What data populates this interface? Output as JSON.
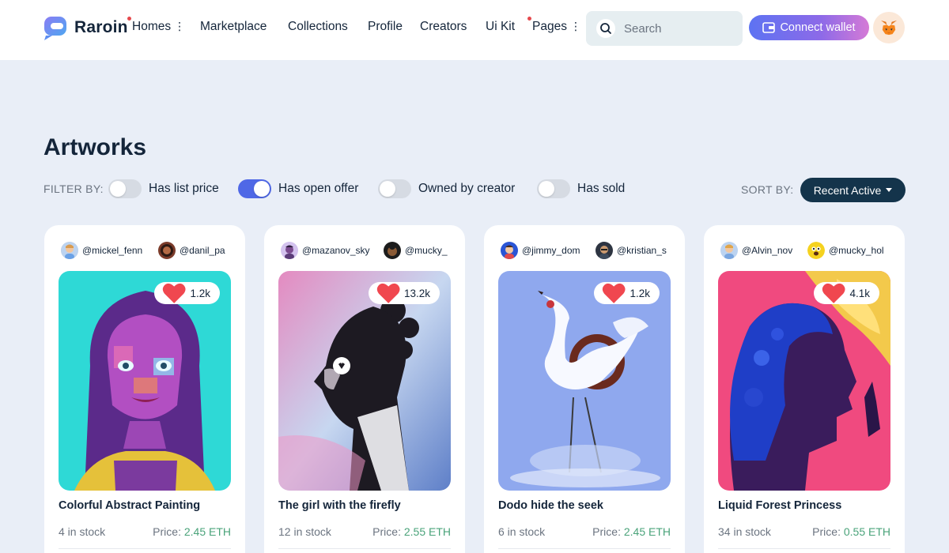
{
  "brand": {
    "name": "Raroin"
  },
  "nav": [
    {
      "label": "Homes",
      "dot": true,
      "kebab": true
    },
    {
      "label": "Marketplace"
    },
    {
      "label": "Collections"
    },
    {
      "label": "Profile"
    },
    {
      "label": "Creators"
    },
    {
      "label": "Ui Kit"
    },
    {
      "label": "Pages",
      "dot": true,
      "kebab": true
    }
  ],
  "search": {
    "placeholder": "Search",
    "value": ""
  },
  "connect_wallet": {
    "label": "Connect wallet"
  },
  "profile": {
    "icon": "metamask-fox-icon"
  },
  "page": {
    "title": "Artworks"
  },
  "filters": {
    "label": "FILTER BY:",
    "items": [
      {
        "label": "Has list price",
        "on": false
      },
      {
        "label": "Has open offer",
        "on": true
      },
      {
        "label": "Owned by creator",
        "on": false
      },
      {
        "label": "Has sold",
        "on": false
      }
    ]
  },
  "sort": {
    "label": "SORT BY:",
    "value": "Recent Active"
  },
  "colors": {
    "accent": "#4f68e6",
    "dark": "#14344b",
    "price": "#4aa37a",
    "like": "#f0474f"
  },
  "cards": [
    {
      "title": "Colorful Abstract Painting",
      "likes": "1.2k",
      "stock": "4 in stock",
      "price_label": "Price:",
      "price": "2.45 ETH",
      "owners": [
        "@mickel_fenn",
        "@danil_pa"
      ]
    },
    {
      "title": "The girl with the firefly",
      "likes": "13.2k",
      "stock": "12 in stock",
      "price_label": "Price:",
      "price": "2.55 ETH",
      "owners": [
        "@mazanov_sky",
        "@mucky_"
      ]
    },
    {
      "title": "Dodo hide the seek",
      "likes": "1.2k",
      "stock": "6 in stock",
      "price_label": "Price:",
      "price": "2.45 ETH",
      "owners": [
        "@jimmy_dom",
        "@kristian_s"
      ]
    },
    {
      "title": "Liquid Forest Princess",
      "likes": "4.1k",
      "stock": "34 in stock",
      "price_label": "Price:",
      "price": "0.55 ETH",
      "owners": [
        "@Alvin_nov",
        "@mucky_hol"
      ]
    }
  ]
}
